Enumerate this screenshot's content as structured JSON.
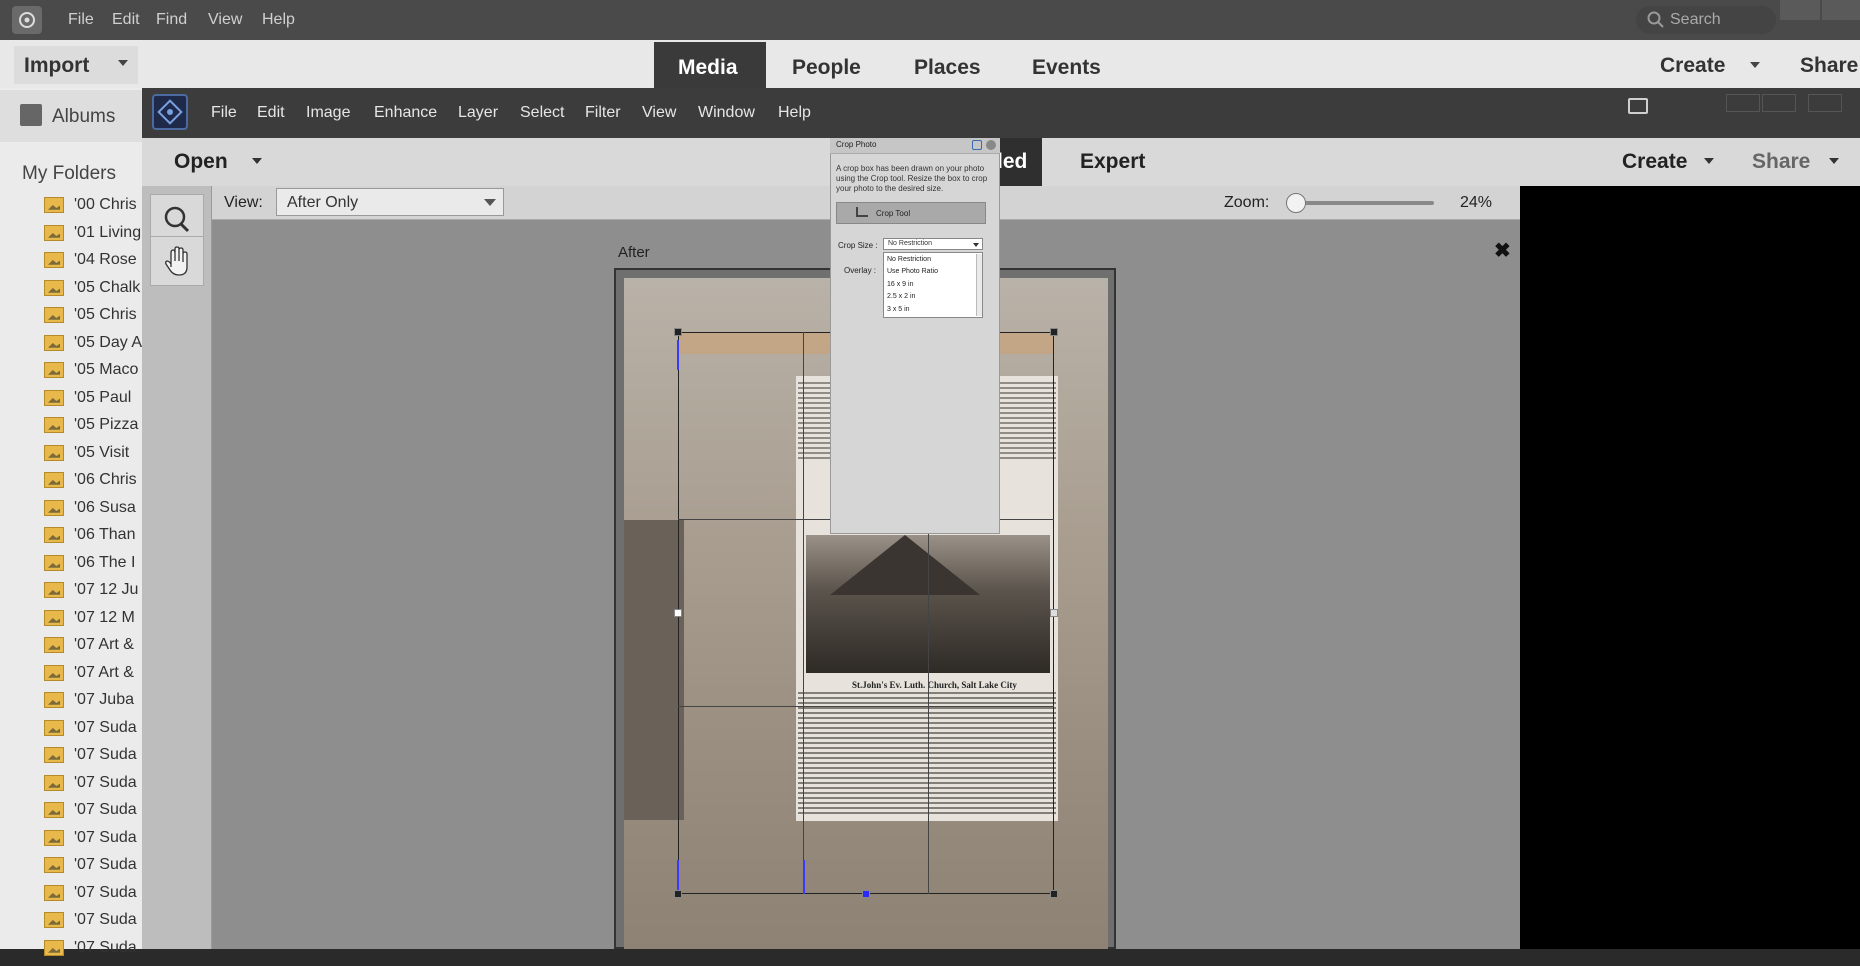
{
  "organizer": {
    "menu": [
      "File",
      "Edit",
      "Find",
      "View",
      "Help"
    ],
    "search_placeholder": "Search",
    "import_label": "Import",
    "tabs": [
      "Media",
      "People",
      "Places",
      "Events"
    ],
    "active_tab": "Media",
    "create_label": "Create",
    "share_label": "Share",
    "albums_label": "Albums",
    "my_folders_label": "My Folders",
    "folders": [
      "'00 Chris",
      "'01 Living",
      "'04 Rose",
      "'05 Chalk",
      "'05 Chris",
      "'05 Day A",
      "'05 Maco",
      "'05 Paul",
      "'05 Pizza",
      "'05 Visit",
      "'06 Chris",
      "'06 Susa",
      "'06 Than",
      "'06 The I",
      "'07 12 Ju",
      "'07 12 M",
      "'07 Art &",
      "'07 Art &",
      "'07 Juba",
      "'07 Suda",
      "'07 Suda",
      "'07 Suda",
      "'07 Suda",
      "'07 Suda",
      "'07 Suda",
      "'07 Suda",
      "'07 Suda",
      "'07 Suda"
    ]
  },
  "editor": {
    "menu": [
      "File",
      "Edit",
      "Image",
      "Enhance",
      "Layer",
      "Select",
      "Filter",
      "View",
      "Window",
      "Help"
    ],
    "open_label": "Open",
    "guided_label": "ded",
    "expert_label": "Expert",
    "create_label": "Create",
    "share_label": "Share",
    "view_label": "View:",
    "view_value": "After Only",
    "zoom_label": "Zoom:",
    "zoom_value": "24%",
    "zoom_fraction": 0.0,
    "after_label": "After",
    "close_symbol": "✖",
    "photo_caption": "St.John's Ev. Luth. Church, Salt Lake City"
  },
  "crop_panel": {
    "title": "Crop Photo",
    "description": "A crop box has been drawn on your photo using the Crop tool. Resize the box to crop your photo to the desired size.",
    "tool_button": "Crop Tool",
    "crop_size_label": "Crop Size :",
    "crop_size_value": "No Restriction",
    "overlay_label": "Overlay :",
    "options": [
      "No Restriction",
      "Use Photo Ratio",
      "16 x 9 in",
      "2.5 x 2 in",
      "3 x 5 in"
    ]
  },
  "colors": {
    "organizer_menubar": "#4a4a4a",
    "editor_menubar": "#3c3c3c",
    "canvas_bg": "#8e8e8e",
    "folder_icon": "#e8b84a"
  }
}
